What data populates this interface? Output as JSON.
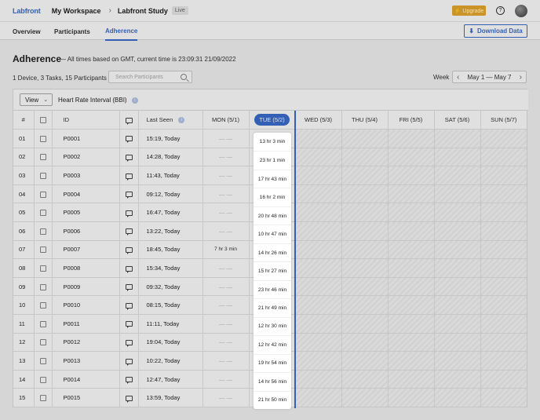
{
  "topbar": {
    "logo": "Labfront",
    "workspace": "My Workspace",
    "study": "Labfront Study",
    "status": "Live",
    "upgrade": "⚡ Upgrade",
    "help": "?"
  },
  "tabs": [
    "Overview",
    "Participants",
    "Adherence"
  ],
  "download_label": "Download Data",
  "heading": "Adherence",
  "subtitle": "— All times based on GMT, current time is 23:09:31 21/09/2022",
  "counts": "1 Device, 3 Tasks, 15 Participants",
  "search_placeholder": "Search Participants",
  "week": {
    "label": "Week",
    "range": "May 1 — May 7"
  },
  "panel": {
    "view": "View",
    "metric": "Heart Rate Interval (BBI)"
  },
  "columns": {
    "num": "#",
    "id": "ID",
    "last_seen": "Last Seen",
    "days": [
      "MON (5/1)",
      "TUE (5/2)",
      "WED (5/3)",
      "THU (5/4)",
      "FRI (5/5)",
      "SAT (5/6)",
      "SUN (5/7)"
    ]
  },
  "rows": [
    {
      "n": "01",
      "id": "P0001",
      "seen": "15:19, Today",
      "mon": "— —",
      "tue": "13 hr 3 min"
    },
    {
      "n": "02",
      "id": "P0002",
      "seen": "14:28, Today",
      "mon": "— —",
      "tue": "23 hr 1 min"
    },
    {
      "n": "03",
      "id": "P0003",
      "seen": "11:43, Today",
      "mon": "— —",
      "tue": "17 hr 43 min"
    },
    {
      "n": "04",
      "id": "P0004",
      "seen": "09:12, Today",
      "mon": "— —",
      "tue": "16 hr 2 min"
    },
    {
      "n": "05",
      "id": "P0005",
      "seen": "16:47, Today",
      "mon": "— —",
      "tue": "20 hr 48 min"
    },
    {
      "n": "06",
      "id": "P0006",
      "seen": "13:22, Today",
      "mon": "— —",
      "tue": "10 hr 47 min"
    },
    {
      "n": "07",
      "id": "P0007",
      "seen": "18:45, Today",
      "mon": "7 hr 3 min",
      "tue": "14 hr 26 min"
    },
    {
      "n": "08",
      "id": "P0008",
      "seen": "15:34, Today",
      "mon": "— —",
      "tue": "15 hr 27 min"
    },
    {
      "n": "09",
      "id": "P0009",
      "seen": "09:32, Today",
      "mon": "— —",
      "tue": "23 hr 46 min"
    },
    {
      "n": "10",
      "id": "P0010",
      "seen": "08:15, Today",
      "mon": "— —",
      "tue": "21 hr 49 min"
    },
    {
      "n": "11",
      "id": "P0011",
      "seen": "11:11, Today",
      "mon": "— —",
      "tue": "12 hr 30 min"
    },
    {
      "n": "12",
      "id": "P0012",
      "seen": "19:04, Today",
      "mon": "— —",
      "tue": "12 hr 42 min"
    },
    {
      "n": "13",
      "id": "P0013",
      "seen": "10:22, Today",
      "mon": "— —",
      "tue": "19 hr 54 min"
    },
    {
      "n": "14",
      "id": "P0014",
      "seen": "12:47, Today",
      "mon": "— —",
      "tue": "14 hr 56 min"
    },
    {
      "n": "15",
      "id": "P0015",
      "seen": "13:59, Today",
      "mon": "— —",
      "tue": "21 hr 50 min"
    }
  ],
  "colors": {
    "accent": "#3b6ecf",
    "upgrade": "#e8a92e"
  }
}
